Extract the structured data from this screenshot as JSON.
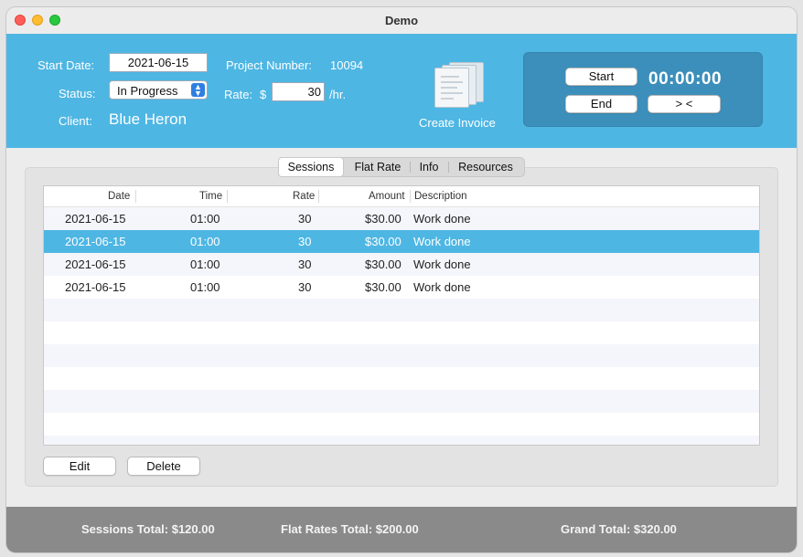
{
  "window": {
    "title": "Demo"
  },
  "header": {
    "start_date_label": "Start Date:",
    "start_date_value": "2021-06-15",
    "status_label": "Status:",
    "status_value": "In Progress",
    "client_label": "Client:",
    "client_value": "Blue Heron",
    "project_number_label": "Project Number:",
    "project_number_value": "10094",
    "rate_label": "Rate:",
    "rate_currency": "$",
    "rate_value": "30",
    "rate_unit": "/hr.",
    "create_invoice_label": "Create Invoice"
  },
  "timer": {
    "start_label": "Start",
    "end_label": "End",
    "swap_label": "> <",
    "clock": "00:00:00"
  },
  "tabs": [
    {
      "label": "Sessions",
      "active": true
    },
    {
      "label": "Flat Rate",
      "active": false
    },
    {
      "label": "Info",
      "active": false
    },
    {
      "label": "Resources",
      "active": false
    }
  ],
  "table": {
    "columns": [
      "Date",
      "Time",
      "Rate",
      "Amount",
      "Description"
    ],
    "rows": [
      {
        "date": "2021-06-15",
        "time": "01:00",
        "rate": "30",
        "amount": "$30.00",
        "description": "Work done"
      },
      {
        "date": "2021-06-15",
        "time": "01:00",
        "rate": "30",
        "amount": "$30.00",
        "description": "Work done"
      },
      {
        "date": "2021-06-15",
        "time": "01:00",
        "rate": "30",
        "amount": "$30.00",
        "description": "Work done"
      },
      {
        "date": "2021-06-15",
        "time": "01:00",
        "rate": "30",
        "amount": "$30.00",
        "description": "Work done"
      }
    ],
    "selected_row": 1
  },
  "actions": {
    "edit_label": "Edit",
    "delete_label": "Delete"
  },
  "footer": {
    "sessions_total": "Sessions Total: $120.00",
    "flat_rates_total": "Flat Rates Total: $200.00",
    "grand_total": "Grand Total: $320.00"
  },
  "colors": {
    "accent": "#4eb6e3",
    "timer_panel": "#3c8fba",
    "footer": "#8a8a8a"
  }
}
